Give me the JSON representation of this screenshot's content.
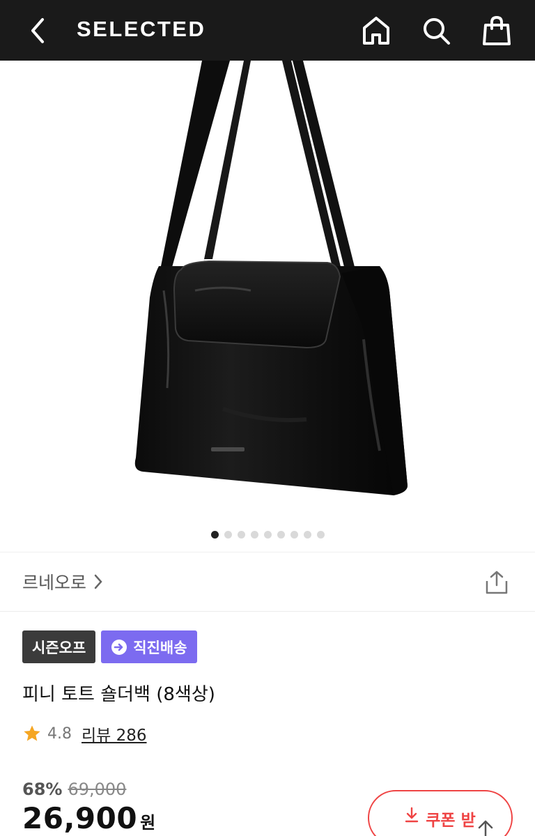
{
  "header": {
    "logo": "SELECTED",
    "icons": {
      "back": "chevron-left-icon",
      "home": "home-icon",
      "search": "search-icon",
      "bag": "shopping-bag-icon"
    },
    "background_color": "#1a1a1a"
  },
  "gallery": {
    "image_alt": "black leather shoulder tote bag",
    "dot_count": 9,
    "active_index": 0
  },
  "brand": {
    "name": "르네오로",
    "share_icon": "share-icon"
  },
  "badges": {
    "season": "시즌오프",
    "direct": "직진배송",
    "direct_color": "#7c6bf0"
  },
  "product": {
    "title": "피니 토트 숄더백 (8색상)",
    "rating": "4.8",
    "review_label": "리뷰 286"
  },
  "price": {
    "discount_rate": "68%",
    "original": "69,000",
    "sale": "26,900",
    "currency": "원"
  },
  "coupon": {
    "label": "쿠폰 받",
    "color": "#ef4444"
  }
}
